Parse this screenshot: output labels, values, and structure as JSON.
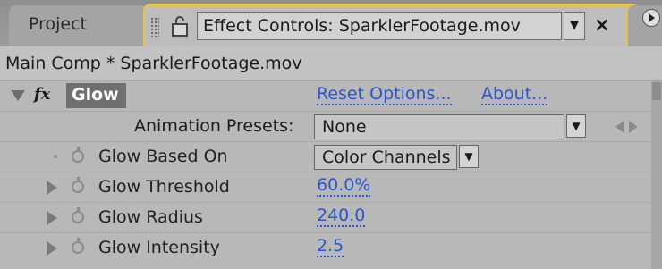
{
  "tabs": {
    "project_label": "Project",
    "effect_controls_title": "Effect Controls: SparklerFootage.mov",
    "dropdown_arrow": "▼",
    "close": "×"
  },
  "comp_header": "Main Comp * SparklerFootage.mov",
  "effect": {
    "icon": "fx",
    "name": "Glow",
    "reset_options": "Reset Options...",
    "about": "About..."
  },
  "presets": {
    "label": "Animation Presets:",
    "value": "None"
  },
  "properties": [
    {
      "label": "Glow Based On",
      "value": "Color Channels"
    },
    {
      "label": "Glow Threshold",
      "value": "60.0%"
    },
    {
      "label": "Glow Radius",
      "value": "240.0"
    },
    {
      "label": "Glow Intensity",
      "value": "2.5"
    }
  ],
  "colors": {
    "accent_tab_border": "#e9c44a",
    "link": "#2a56c6",
    "effect_badge": "#6f6f6f"
  }
}
